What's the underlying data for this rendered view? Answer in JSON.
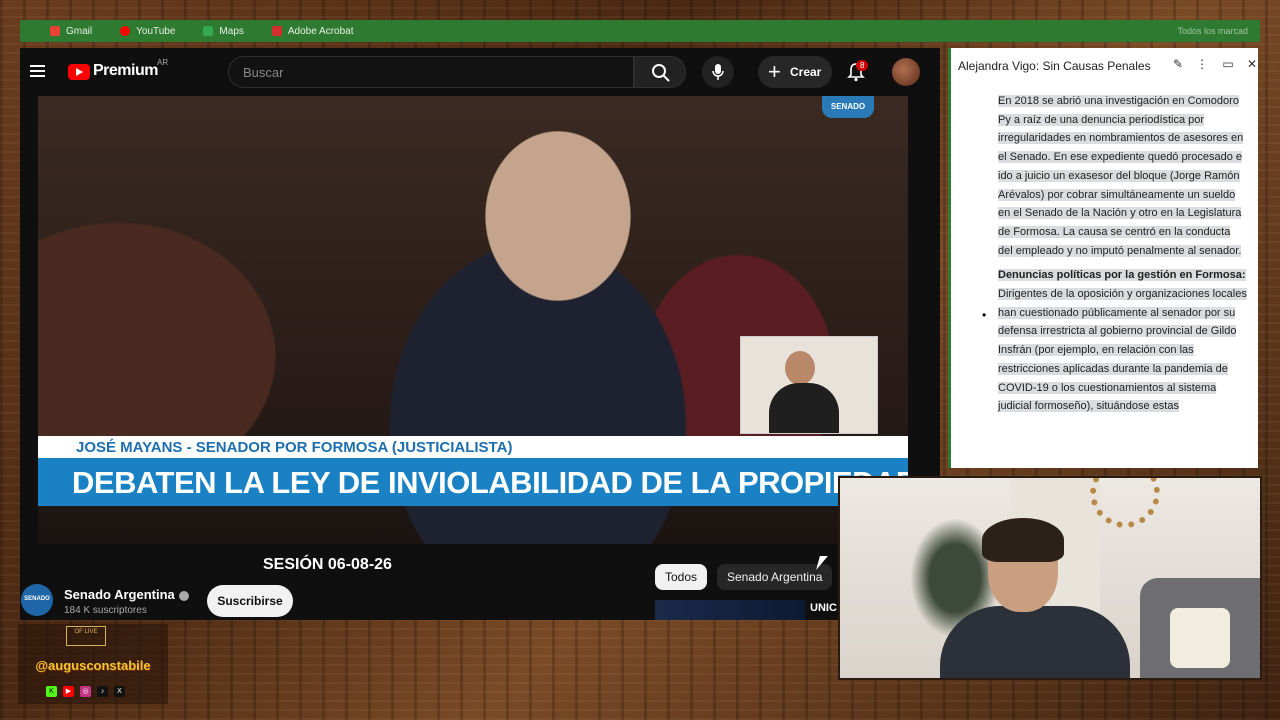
{
  "bookmarks": {
    "items": [
      {
        "label": "Gmail",
        "icon": "gmail-icon",
        "color": "#ea4335"
      },
      {
        "label": "YouTube",
        "icon": "youtube-icon",
        "color": "#ff0000"
      },
      {
        "label": "Maps",
        "icon": "maps-icon",
        "color": "#34a853"
      },
      {
        "label": "Adobe Acrobat",
        "icon": "acrobat-icon",
        "color": "#d32f2f"
      }
    ],
    "all_bookmarks": "Todos los marcad"
  },
  "youtube": {
    "brand": "Premium",
    "country": "AR",
    "search_placeholder": "Buscar",
    "create_label": "Crear",
    "notification_count": "8",
    "video": {
      "logo_text": "SENADO",
      "lower_third_name": "JOSÉ MAYANS - SENADOR POR FORMOSA (JUSTICIALISTA)",
      "headline": "DEBATEN LA LEY DE INVIOLABILIDAD DE LA PROPIEDAD PRIVADA"
    },
    "title": "SESIÓN 06-08-26",
    "channel": {
      "name": "Senado Argentina",
      "subscribers": "184 K suscriptores",
      "avatar_text": "SENADO",
      "subscribe_label": "Suscribirse"
    },
    "chips": [
      "Todos",
      "Senado Argentina"
    ],
    "next_thumb_text": "UNIC"
  },
  "panel": {
    "title": "Alejandra Vigo: Sin Causas Penales",
    "paragraph": "En 2018 se abrió una investigación en Comodoro Py a raíz de una denuncia periodística por irregularidades en nombramientos de asesores en el Senado. En ese expediente quedó procesado e ido a juicio un exasesor del bloque (Jorge Ramón Arévalos) por cobrar simultáneamente un sueldo en el Senado de la Nación y otro en la Legislatura de Formosa. La causa se centró en la conducta del empleado y no imputó penalmente al senador.",
    "bullet_heading": "Denuncias políticas por la gestión en Formosa:",
    "bullet_text": "Dirigentes de la oposición y organizaciones locales han cuestionado públicamente al senador por su defensa irrestricta al gobierno provincial de Gildo Insfrán (por ejemplo, en relación con las restricciones aplicadas durante la pandemia de COVID-19 o los cuestionamientos al sistema judicial formoseño), situándose estas"
  },
  "brand_overlay": {
    "crest": "OF LIVE",
    "handle": "@augusconstabile"
  }
}
